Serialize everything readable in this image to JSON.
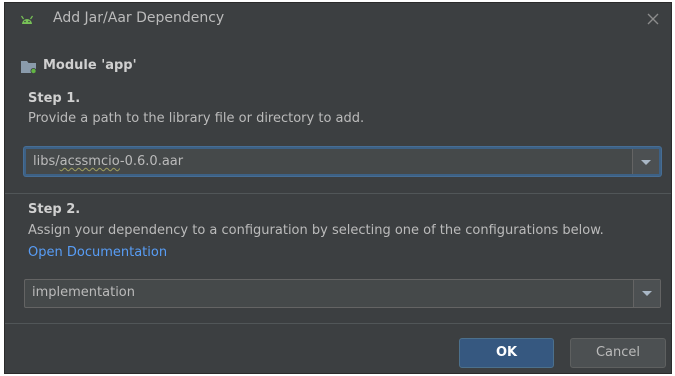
{
  "dialog": {
    "title": "Add Jar/Aar Dependency",
    "app_icon": "android-icon",
    "close_icon": "close-icon"
  },
  "module": {
    "icon": "module-folder-icon",
    "label": "Module 'app'"
  },
  "step1": {
    "title": "Step 1.",
    "description": "Provide a path to the library file or directory to add.",
    "path_prefix": "libs/",
    "path_underlined": "acssmcio",
    "path_suffix": "-0.6.0.aar"
  },
  "step2": {
    "title": "Step 2.",
    "description": "Assign your dependency to a configuration by selecting one of the configurations below.",
    "link": "Open Documentation",
    "configuration": "implementation"
  },
  "buttons": {
    "ok": "OK",
    "cancel": "Cancel"
  },
  "colors": {
    "background": "#3c3f41",
    "text": "#bbbbbb",
    "link": "#589df6",
    "primary_button": "#365880",
    "focus_border": "#3d6185"
  }
}
